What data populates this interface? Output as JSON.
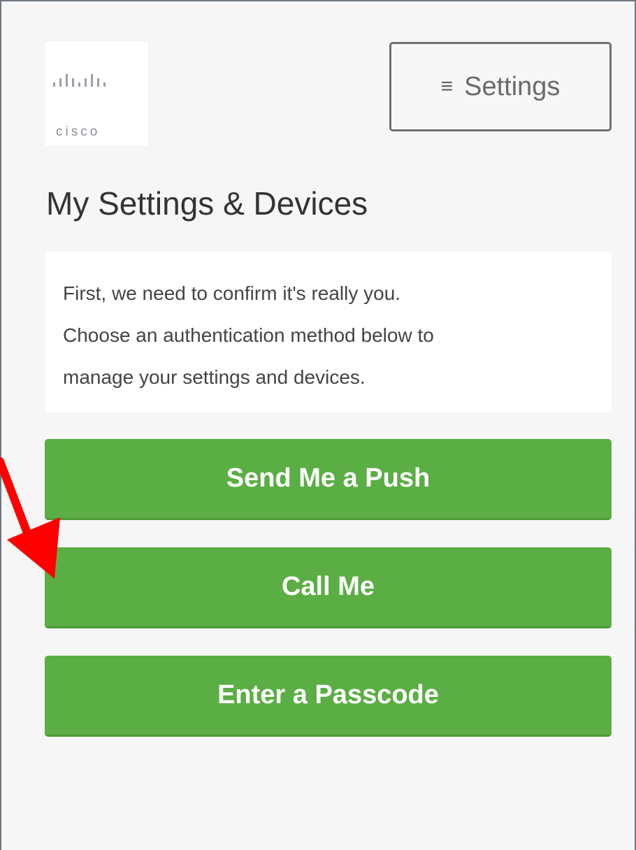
{
  "logo": {
    "text": "cisco"
  },
  "header": {
    "settings_icon": "menu-icon",
    "settings_label": "Settings"
  },
  "main": {
    "title": "My Settings & Devices",
    "info_lines": [
      "First, we need to confirm it's really you.",
      "Choose an authentication method below to",
      "manage your settings and devices."
    ],
    "buttons": [
      {
        "label": "Send Me a Push"
      },
      {
        "label": "Call Me"
      },
      {
        "label": "Enter a Passcode"
      }
    ]
  },
  "annotation": {
    "arrow_color": "#ff0000",
    "points_to": "Call Me"
  },
  "colors": {
    "button_green": "#5bae44",
    "background": "#f6f6f6"
  }
}
